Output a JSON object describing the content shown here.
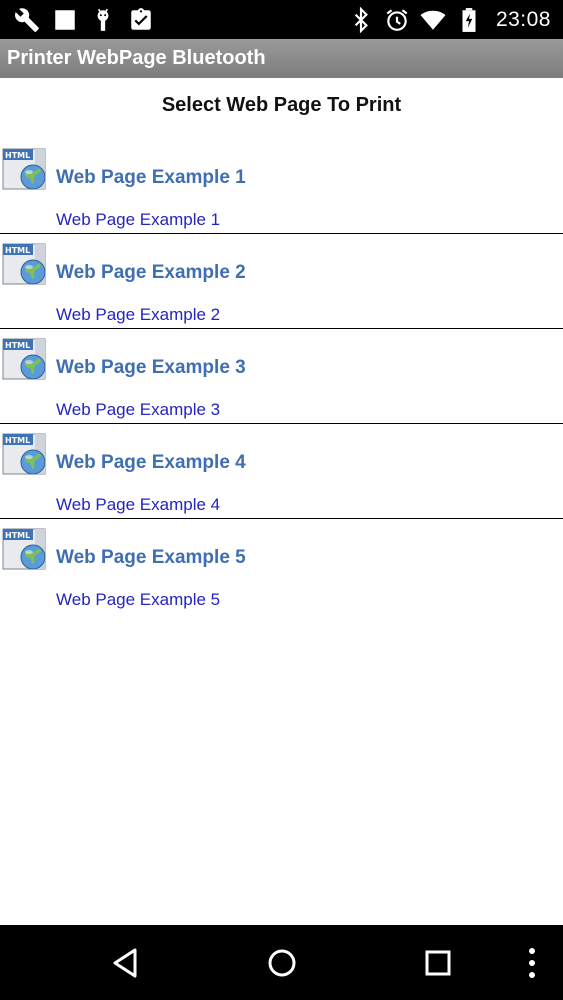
{
  "status_bar": {
    "time": "23:08",
    "left_icons": [
      "wrench-icon",
      "square-icon",
      "android-icon",
      "clipboard-check-icon"
    ],
    "right_icons": [
      "bluetooth-icon",
      "alarm-icon",
      "wifi-icon",
      "battery-charging-icon"
    ]
  },
  "app": {
    "title": "Printer WebPage Bluetooth"
  },
  "main": {
    "heading": "Select Web Page To Print",
    "items": [
      {
        "title": "Web Page Example 1",
        "subtitle": "Web Page Example 1",
        "icon": "html-globe-icon"
      },
      {
        "title": "Web Page Example 2",
        "subtitle": "Web Page Example 2",
        "icon": "html-globe-icon"
      },
      {
        "title": "Web Page Example 3",
        "subtitle": "Web Page Example 3",
        "icon": "html-globe-icon"
      },
      {
        "title": "Web Page Example 4",
        "subtitle": "Web Page Example 4",
        "icon": "html-globe-icon"
      },
      {
        "title": "Web Page Example 5",
        "subtitle": "Web Page Example 5",
        "icon": "html-globe-icon"
      }
    ]
  },
  "nav_bar": {
    "buttons": [
      "back-icon",
      "home-icon",
      "recents-icon",
      "overflow-menu-icon"
    ]
  },
  "colors": {
    "title_bar": "#8a8a8a",
    "item_title": "#3f6fb0",
    "item_subtitle": "#2424c0",
    "status_bar": "#000000"
  }
}
